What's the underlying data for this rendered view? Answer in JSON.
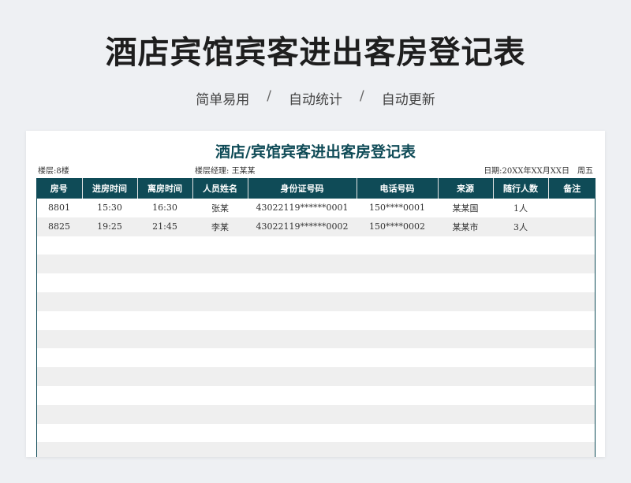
{
  "banner": {
    "title": "酒店宾馆宾客进出客房登记表",
    "tagline": [
      "简单易用",
      "自动统计",
      "自动更新"
    ],
    "separator": "/"
  },
  "sheet": {
    "title": "酒店/宾馆宾客进出客房登记表",
    "floor": "楼层:8楼",
    "manager_label": "楼层经理:",
    "manager_name": "王某某",
    "date_label": "日期:20XX年XX月XX日",
    "weekday": "周五"
  },
  "table": {
    "headers": [
      "房号",
      "进房时间",
      "离房时间",
      "人员姓名",
      "身份证号码",
      "电话号码",
      "来源",
      "随行人数",
      "备注"
    ],
    "rows": [
      [
        "8801",
        "15:30",
        "16:30",
        "张某",
        "43022119******0001",
        "150****0001",
        "某某国",
        "1人",
        ""
      ],
      [
        "8825",
        "19:25",
        "21:45",
        "李某",
        "43022119******0002",
        "150****0002",
        "某某市",
        "3人",
        ""
      ]
    ]
  },
  "colors": {
    "header_bg": "#0f4b57",
    "stripe": "#efefef",
    "title_color": "#0f4b57"
  }
}
